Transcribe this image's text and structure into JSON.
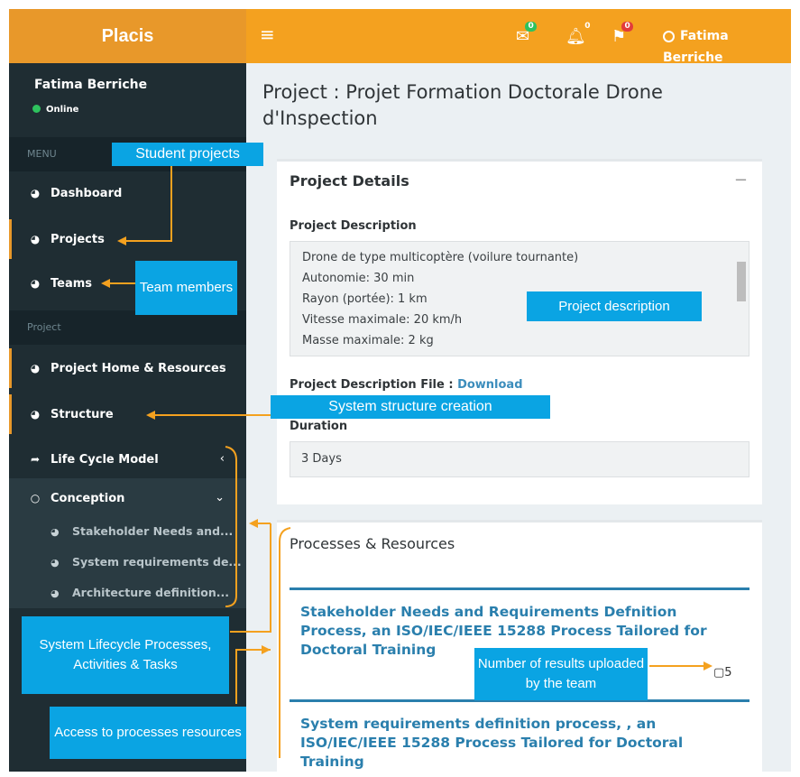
{
  "topbar": {
    "brand": "Placis",
    "menu_icon": "hamburger-icon",
    "mail_badge": "0",
    "bell_badge": "0",
    "flag_badge": "0",
    "user_name": "Fatima Berriche",
    "colors": {
      "bar": "#f4a11f",
      "mail_badge": "#2ec25e",
      "bell_badge": "#f4a11f",
      "flag_badge": "#e23b3b"
    }
  },
  "sidebar": {
    "user_name": "Fatima Berriche",
    "status": "Online",
    "menu_header": "MENU",
    "project_header": "Project",
    "items": [
      {
        "label": "Dashboard",
        "icon": "dashboard-icon"
      },
      {
        "label": "Projects",
        "icon": "dashboard-icon"
      },
      {
        "label": "Teams",
        "icon": "dashboard-icon"
      },
      {
        "label": "Project Home & Resources",
        "icon": "dashboard-icon"
      },
      {
        "label": "Structure",
        "icon": "dashboard-icon"
      },
      {
        "label": "Life Cycle Model",
        "icon": "share-arrow-icon"
      },
      {
        "label": "Conception",
        "icon": "circle-icon"
      }
    ],
    "subitems": [
      "Stakeholder Needs and...",
      "System requirements de...",
      "Architecture definition..."
    ]
  },
  "main": {
    "title": "Project : Projet Formation Doctorale Drone d'Inspection",
    "details": {
      "title": "Project Details",
      "desc_label": "Project Description",
      "desc_lines": [
        "Drone de type multicoptère (voilure tournante)",
        "Autonomie: 30 min",
        "Rayon (portée): 1 km",
        "Vitesse maximale: 20 km/h",
        "Masse maximale: 2 kg"
      ],
      "file_label": "Project Description File : ",
      "file_link": "Download",
      "duration_label": "Duration",
      "duration_value": "3 Days"
    },
    "processes": {
      "title": "Processes & Resources",
      "items": [
        {
          "title": "Stakeholder Needs and Requirements Defnition Process, an ISO/IEC/IEEE 15288 Process Tailored for Doctoral Training",
          "count": "5"
        },
        {
          "title": "System requirements definition process, , an ISO/IEC/IEEE 15288 Process Tailored for Doctoral Training",
          "count": ""
        }
      ]
    }
  },
  "annotations": {
    "student_projects": "Student projects",
    "team_members": "Team members",
    "project_description": "Project description",
    "structure_creation": "System structure creation",
    "lifecycle": "System Lifecycle Processes, Activities & Tasks",
    "resources_access": "Access to processes resources",
    "results_count": "Number of results uploaded by the team",
    "color": "#0aa4e3"
  }
}
